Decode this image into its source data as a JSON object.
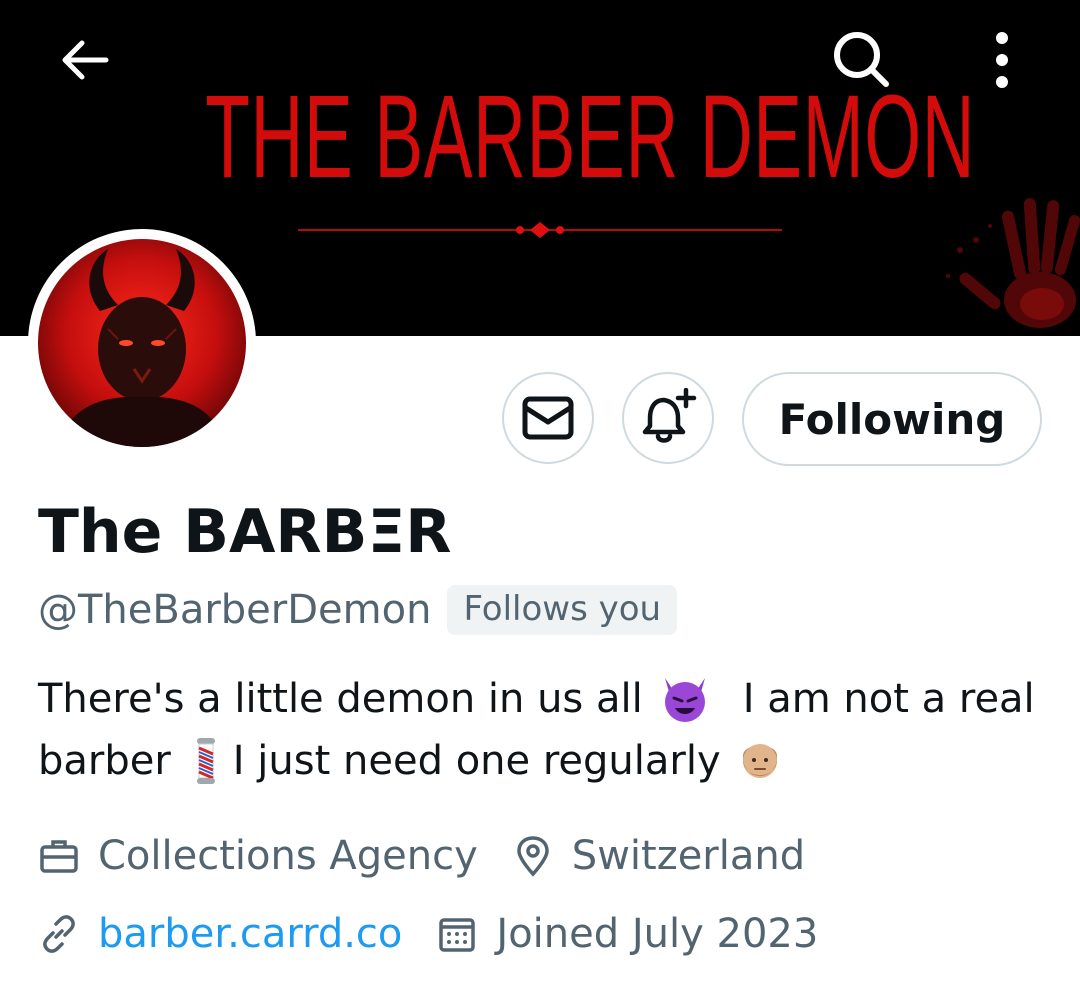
{
  "banner": {
    "title": "THE BARBER DEMON"
  },
  "profile": {
    "display_name": "The BARBΞR",
    "handle": "@TheBarberDemon",
    "follows_you_badge": "Follows you",
    "bio_line1_part1": "There's a little demon in us all",
    "bio_line1_part2": "I am not a real",
    "bio_line2_part1": "barber",
    "bio_line2_part2": "I just need one regularly",
    "category": "Collections Agency",
    "location": "Switzerland",
    "website": "barber.carrd.co",
    "joined": "Joined July 2023"
  },
  "actions": {
    "following_label": "Following"
  },
  "icons": {
    "back": "back-arrow-icon",
    "search": "search-icon",
    "more": "more-vertical-icon",
    "message": "envelope-icon",
    "notify": "bell-plus-icon",
    "category": "briefcase-icon",
    "location": "location-pin-icon",
    "website": "link-icon",
    "joined": "calendar-icon"
  },
  "colors": {
    "banner_bg": "#000000",
    "banner_title": "#d40b0b",
    "link": "#1d9bf0",
    "secondary_text": "#536471",
    "primary_text": "#0f1419",
    "border": "#cfd9de"
  }
}
